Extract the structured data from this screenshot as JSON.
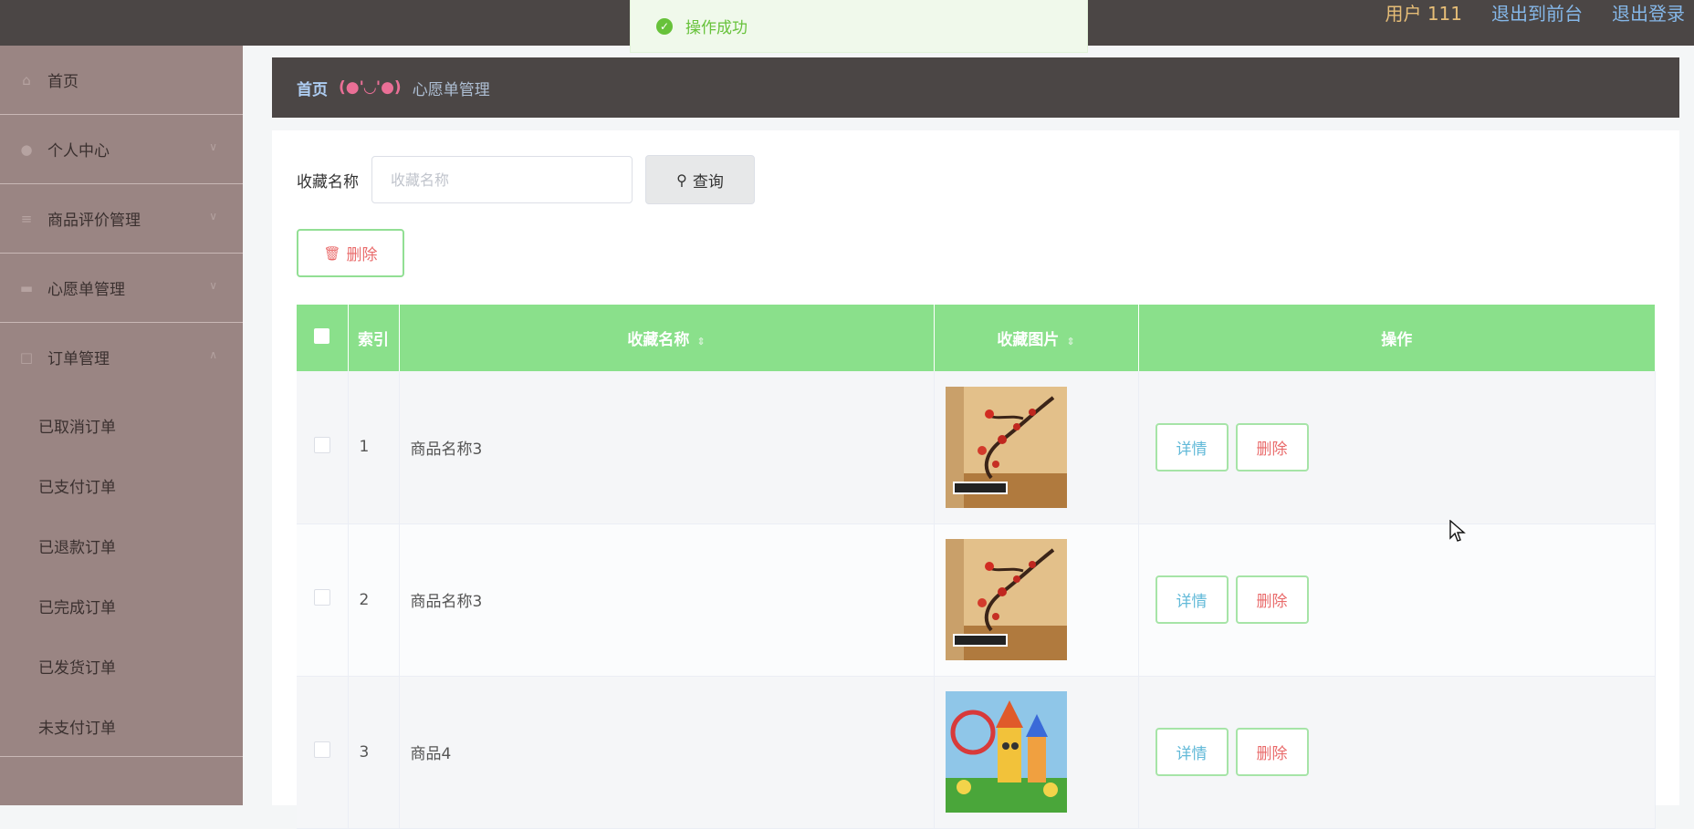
{
  "header": {
    "user_label": "用户 111",
    "to_front_label": "退出到前台",
    "logout_label": "退出登录"
  },
  "toast": {
    "message": "操作成功"
  },
  "sidebar": {
    "items": [
      {
        "label": "首页",
        "icon": "home-icon"
      },
      {
        "label": "个人中心",
        "icon": "user-icon"
      },
      {
        "label": "商品评价管理",
        "icon": "sliders-icon"
      },
      {
        "label": "心愿单管理",
        "icon": "cup-icon"
      },
      {
        "label": "订单管理",
        "icon": "order-icon"
      }
    ],
    "order_sub_items": [
      "已取消订单",
      "已支付订单",
      "已退款订单",
      "已完成订单",
      "已发货订单",
      "未支付订单"
    ]
  },
  "breadcrumb": {
    "home": "首页",
    "separator": "(●'◡'●)",
    "current": "心愿单管理"
  },
  "search": {
    "label": "收藏名称",
    "placeholder": "收藏名称",
    "value": "",
    "button_label": "查询"
  },
  "toolbar": {
    "delete_label": "删除"
  },
  "table": {
    "columns": [
      "索引",
      "收藏名称",
      "收藏图片",
      "操作"
    ],
    "rows": [
      {
        "index": "1",
        "name": "商品名称3",
        "image": "blossom-mural-image"
      },
      {
        "index": "2",
        "name": "商品名称3",
        "image": "blossom-mural-image"
      },
      {
        "index": "3",
        "name": "商品4",
        "image": "castle-mural-image"
      }
    ],
    "detail_label": "详情",
    "delete_label": "删除"
  },
  "colors": {
    "topbar": "#4b4645",
    "sidebar": "#9a8583",
    "table_header": "#8ae08b",
    "detail_text": "#61b9d8",
    "delete_text": "#e96b6b",
    "success": "#67c23a"
  }
}
